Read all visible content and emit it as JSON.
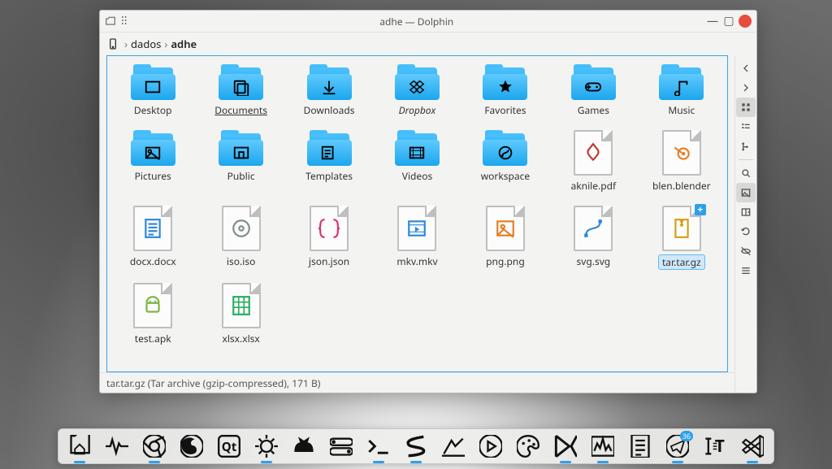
{
  "window": {
    "title": "adhe — Dolphin",
    "breadcrumb": [
      "dados",
      "adhe"
    ],
    "status": "tar.tar.gz (Tar archive (gzip-compressed), 171 B)"
  },
  "items": [
    {
      "kind": "folder",
      "label": "Desktop",
      "glyph": "desktop"
    },
    {
      "kind": "folder",
      "label": "Documents",
      "glyph": "documents",
      "underline": true
    },
    {
      "kind": "folder",
      "label": "Downloads",
      "glyph": "download"
    },
    {
      "kind": "folder",
      "label": "Dropbox",
      "glyph": "dropbox",
      "italic": true
    },
    {
      "kind": "folder",
      "label": "Favorites",
      "glyph": "star"
    },
    {
      "kind": "folder",
      "label": "Games",
      "glyph": "gamepad"
    },
    {
      "kind": "folder",
      "label": "Music",
      "glyph": "music"
    },
    {
      "kind": "folder",
      "label": "Pictures",
      "glyph": "picture"
    },
    {
      "kind": "folder",
      "label": "Public",
      "glyph": "public"
    },
    {
      "kind": "folder",
      "label": "Templates",
      "glyph": "template"
    },
    {
      "kind": "folder",
      "label": "Videos",
      "glyph": "video"
    },
    {
      "kind": "folder",
      "label": "workspace",
      "glyph": "git"
    },
    {
      "kind": "file",
      "label": "aknile.pdf",
      "glyph": "pdf",
      "glyph_color": "#c0392b"
    },
    {
      "kind": "file",
      "label": "blen.blender",
      "glyph": "blender",
      "glyph_color": "#e67e22"
    },
    {
      "kind": "file",
      "label": "docx.docx",
      "glyph": "docx",
      "glyph_color": "#2e86de"
    },
    {
      "kind": "file",
      "label": "iso.iso",
      "glyph": "iso",
      "glyph_color": "#7f8c8d"
    },
    {
      "kind": "file",
      "label": "json.json",
      "glyph": "json",
      "glyph_color": "#d6336c"
    },
    {
      "kind": "file",
      "label": "mkv.mkv",
      "glyph": "mkv",
      "glyph_color": "#2e86de"
    },
    {
      "kind": "file",
      "label": "png.png",
      "glyph": "png",
      "glyph_color": "#e67e22"
    },
    {
      "kind": "file",
      "label": "svg.svg",
      "glyph": "svg",
      "glyph_color": "#2e86de"
    },
    {
      "kind": "file",
      "label": "tar.tar.gz",
      "glyph": "tar",
      "glyph_color": "#d4a017",
      "selected": true,
      "badge": "+"
    },
    {
      "kind": "file",
      "label": "test.apk",
      "glyph": "apk",
      "glyph_color": "#7cb342"
    },
    {
      "kind": "file",
      "label": "xlsx.xlsx",
      "glyph": "xlsx",
      "glyph_color": "#27ae60"
    }
  ],
  "side_tools": [
    {
      "name": "nav-back",
      "glyph": "chev-left"
    },
    {
      "name": "nav-forward",
      "glyph": "chev-right"
    },
    {
      "name": "view-icons",
      "glyph": "grid",
      "active": true
    },
    {
      "name": "view-compact",
      "glyph": "list"
    },
    {
      "name": "view-details",
      "glyph": "tree"
    },
    {
      "name": "sep"
    },
    {
      "name": "search",
      "glyph": "search"
    },
    {
      "name": "preview",
      "glyph": "image",
      "active": true
    },
    {
      "name": "split",
      "glyph": "split"
    },
    {
      "name": "reload",
      "glyph": "reload"
    },
    {
      "name": "hidden",
      "glyph": "eye"
    },
    {
      "name": "menu",
      "glyph": "menu"
    }
  ],
  "dock": [
    {
      "name": "files",
      "glyph": "home",
      "running": true
    },
    {
      "name": "pulse",
      "glyph": "pulse"
    },
    {
      "name": "chrome",
      "glyph": "chrome",
      "running": true
    },
    {
      "name": "firefox",
      "glyph": "firefox"
    },
    {
      "name": "qt",
      "glyph": "qt"
    },
    {
      "name": "settings",
      "glyph": "gear",
      "running": true
    },
    {
      "name": "cat",
      "glyph": "cat"
    },
    {
      "name": "toggle",
      "glyph": "toggle"
    },
    {
      "name": "terminal",
      "glyph": "terminal",
      "running": true
    },
    {
      "name": "sublime",
      "glyph": "sublime",
      "running": true
    },
    {
      "name": "gimp-alt",
      "glyph": "krita"
    },
    {
      "name": "play",
      "glyph": "play"
    },
    {
      "name": "gimp",
      "glyph": "palette"
    },
    {
      "name": "kate",
      "glyph": "kate",
      "running": true
    },
    {
      "name": "monitor",
      "glyph": "monitor",
      "running": true
    },
    {
      "name": "notes",
      "glyph": "notes"
    },
    {
      "name": "telegram",
      "glyph": "telegram",
      "badge": "36",
      "running": true
    },
    {
      "name": "typography",
      "glyph": "typography"
    },
    {
      "name": "vscode",
      "glyph": "vscode",
      "running": true
    }
  ]
}
